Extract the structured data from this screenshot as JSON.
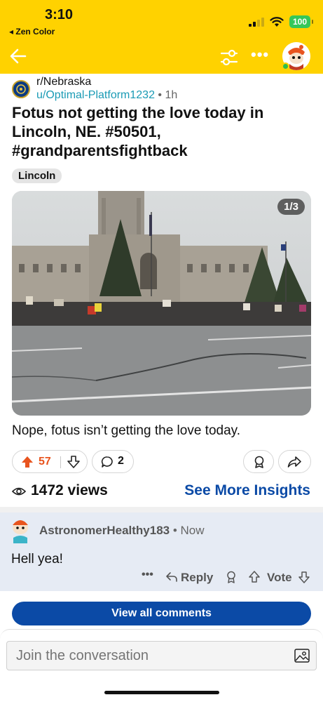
{
  "status_bar": {
    "time": "3:10",
    "back_app": "◂ Zen Color",
    "battery": "100"
  },
  "post": {
    "subreddit": "r/Nebraska",
    "author": "u/Optimal-Platform1232",
    "separator": " • ",
    "age": "1h",
    "title": "Fotus not getting the love today in Lincoln, NE. #50501, #grandparentsfightback",
    "flair": "Lincoln",
    "image_counter": "1/3",
    "body": "Nope, fotus isn’t getting the love today.",
    "upvotes": "57",
    "comments": "2",
    "views": "1472 views",
    "insights_link": "See More Insights"
  },
  "comment": {
    "author": "AstronomerHealthy183",
    "time": " • Now",
    "text": "Hell yea!",
    "more": "•••",
    "reply_label": "Reply",
    "vote_label": "Vote"
  },
  "view_all_label": "View all comments",
  "composer": {
    "placeholder": "Join the conversation"
  },
  "colors": {
    "header_bg": "#FFD200",
    "upvote": "#e8541e",
    "link_blue": "#0b4aa6",
    "author_teal": "#1a9bb5",
    "comment_bg": "#e6ebf4"
  },
  "icons": [
    "back-arrow-icon",
    "filter-icon",
    "more-icon",
    "avatar",
    "upvote-icon",
    "downvote-icon",
    "comment-icon",
    "award-icon",
    "share-icon",
    "views-icon",
    "reply-icon",
    "image-upload-icon"
  ]
}
